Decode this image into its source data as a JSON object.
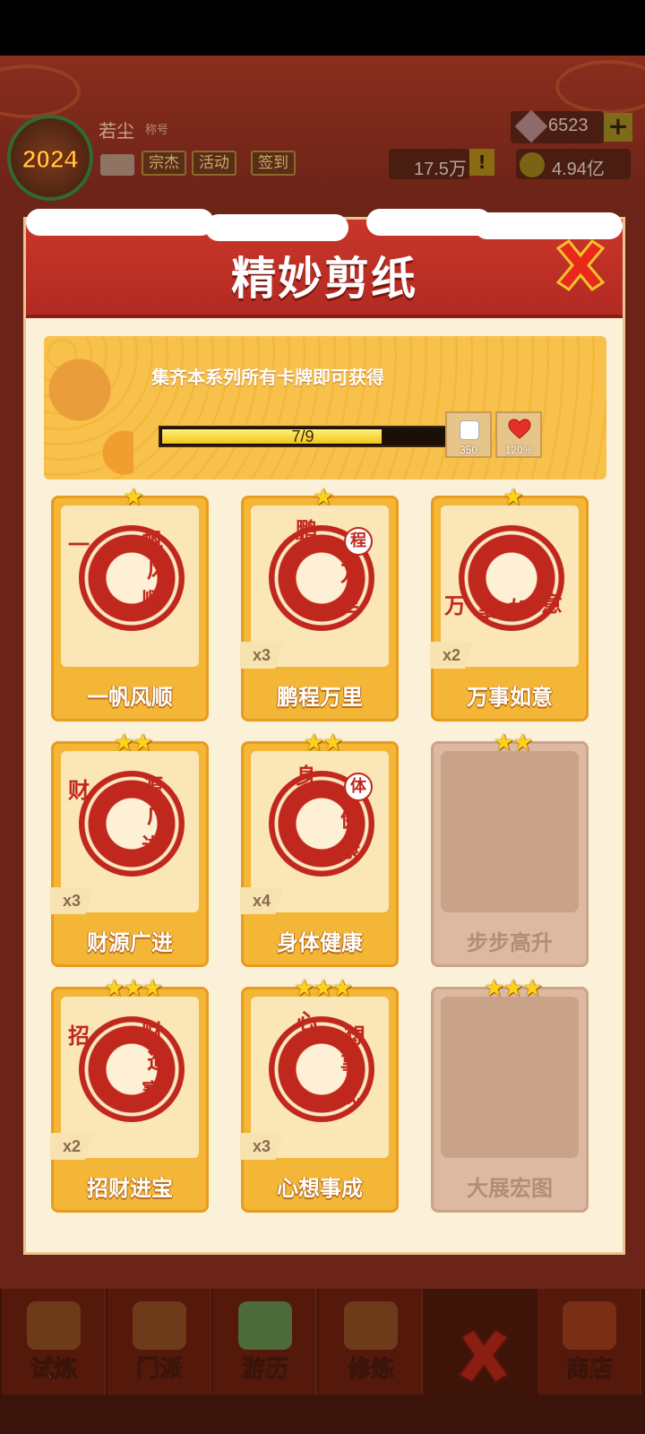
{
  "topbar": {
    "player_name": "若尘",
    "player_rank": "称号",
    "avatar_year": "2024",
    "buttons": [
      "宗杰",
      "活动",
      "签到"
    ],
    "gems": "6523",
    "power": "17.5万",
    "coins": "4.94亿",
    "plus": "+",
    "warn": "!"
  },
  "modal": {
    "title": "精妙剪纸",
    "banner_text": "集齐本系列所有卡牌即可获得",
    "progress_text": "7/9",
    "progress_fraction": 0.78,
    "rewards": [
      {
        "icon": "dice-icon",
        "label": "350"
      },
      {
        "icon": "heart-icon",
        "label": "120%"
      }
    ],
    "cards": [
      {
        "name": "一帆风顺",
        "stars": "★",
        "count": "",
        "locked": false,
        "chars": [
          "一",
          "帆",
          "风",
          "顺"
        ]
      },
      {
        "name": "鹏程万里",
        "stars": "★",
        "count": "x3",
        "locked": false,
        "chars": [
          "鹏",
          "程",
          "万",
          "里"
        ]
      },
      {
        "name": "万事如意",
        "stars": "★",
        "count": "x2",
        "locked": false,
        "chars": [
          "万",
          "事",
          "如",
          "意"
        ]
      },
      {
        "name": "财源广进",
        "stars": "★★",
        "count": "x3",
        "locked": false,
        "chars": [
          "财",
          "源",
          "广",
          "进"
        ]
      },
      {
        "name": "身体健康",
        "stars": "★★",
        "count": "x4",
        "locked": false,
        "chars": [
          "身",
          "体",
          "健",
          "康"
        ]
      },
      {
        "name": "步步高升",
        "stars": "★★",
        "count": "",
        "locked": true,
        "chars": []
      },
      {
        "name": "招财进宝",
        "stars": "★★★",
        "count": "x2",
        "locked": false,
        "chars": [
          "招",
          "财",
          "進",
          "寶"
        ]
      },
      {
        "name": "心想事成",
        "stars": "★★★",
        "count": "x3",
        "locked": false,
        "chars": [
          "心",
          "想",
          "事",
          "成"
        ]
      },
      {
        "name": "大展宏图",
        "stars": "★★★",
        "count": "",
        "locked": true,
        "chars": []
      }
    ]
  },
  "bottom_nav": [
    {
      "label": "试炼",
      "icon": "trial-icon"
    },
    {
      "label": "门派",
      "icon": "sect-icon"
    },
    {
      "label": "游历",
      "icon": "travel-icon"
    },
    {
      "label": "修炼",
      "icon": "cultivate-icon"
    },
    {
      "label": "",
      "icon": "close-icon"
    },
    {
      "label": "商店",
      "icon": "shop-icon"
    }
  ],
  "colors": {
    "header_red": "#c9362a",
    "card_gold": "#f4b636",
    "paper_red": "#c1281d",
    "close_red": "#e8291c"
  }
}
